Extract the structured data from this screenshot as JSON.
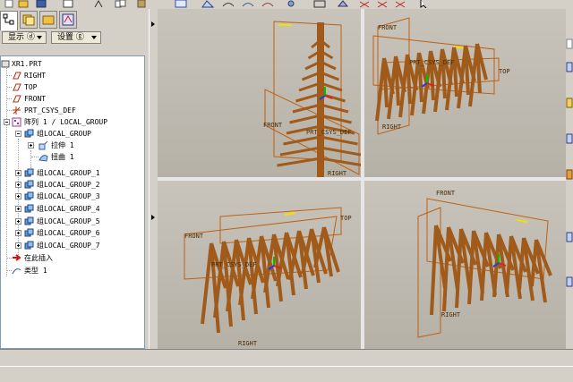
{
  "menu": {
    "display_label": "显示 ⓓ",
    "settings_label": "设置 ⓖ"
  },
  "tree": {
    "items": [
      {
        "label": "XR1.PRT",
        "icon": "part-icon"
      },
      {
        "label": "RIGHT",
        "icon": "datum-plane-icon"
      },
      {
        "label": "TOP",
        "icon": "datum-plane-icon"
      },
      {
        "label": "FRONT",
        "icon": "datum-plane-icon"
      },
      {
        "label": "PRT_CSYS_DEF",
        "icon": "csys-icon"
      },
      {
        "label": "阵列 1 / LOCAL_GROUP",
        "icon": "pattern-icon"
      },
      {
        "label": "组LOCAL_GROUP",
        "icon": "group-icon"
      },
      {
        "label": "拉伸 1",
        "icon": "extrude-icon"
      },
      {
        "label": "扭曲 1",
        "icon": "warp-icon"
      },
      {
        "label": "组LOCAL_GROUP_1",
        "icon": "group-icon"
      },
      {
        "label": "组LOCAL_GROUP_2",
        "icon": "group-icon"
      },
      {
        "label": "组LOCAL_GROUP_3",
        "icon": "group-icon"
      },
      {
        "label": "组LOCAL_GROUP_4",
        "icon": "group-icon"
      },
      {
        "label": "组LOCAL_GROUP_5",
        "icon": "group-icon"
      },
      {
        "label": "组LOCAL_GROUP_6",
        "icon": "group-icon"
      },
      {
        "label": "组LOCAL_GROUP_7",
        "icon": "group-icon"
      },
      {
        "label": "在此插入",
        "icon": "insert-here-icon"
      },
      {
        "label": "类型 1",
        "icon": "type-icon"
      }
    ]
  },
  "viewports": {
    "v1": {
      "labels": [
        "FRONT",
        "PRT_CSYS_DEF",
        "RIGHT"
      ]
    },
    "v2": {
      "labels": [
        "FRONT",
        "TOP",
        "PRT_CSYS_DEF",
        "RIGHT"
      ]
    },
    "v3": {
      "labels": [
        "FRONT",
        "TOP",
        "PRT_CSYS_DEF",
        "RIGHT"
      ]
    },
    "v4": {
      "labels": [
        "FRONT",
        "RIGHT"
      ]
    }
  },
  "colors": {
    "model": "#a05a1a",
    "frame": "#c06010",
    "tree_border": "#7f9db9",
    "datum_yellow": "#f0e000"
  }
}
